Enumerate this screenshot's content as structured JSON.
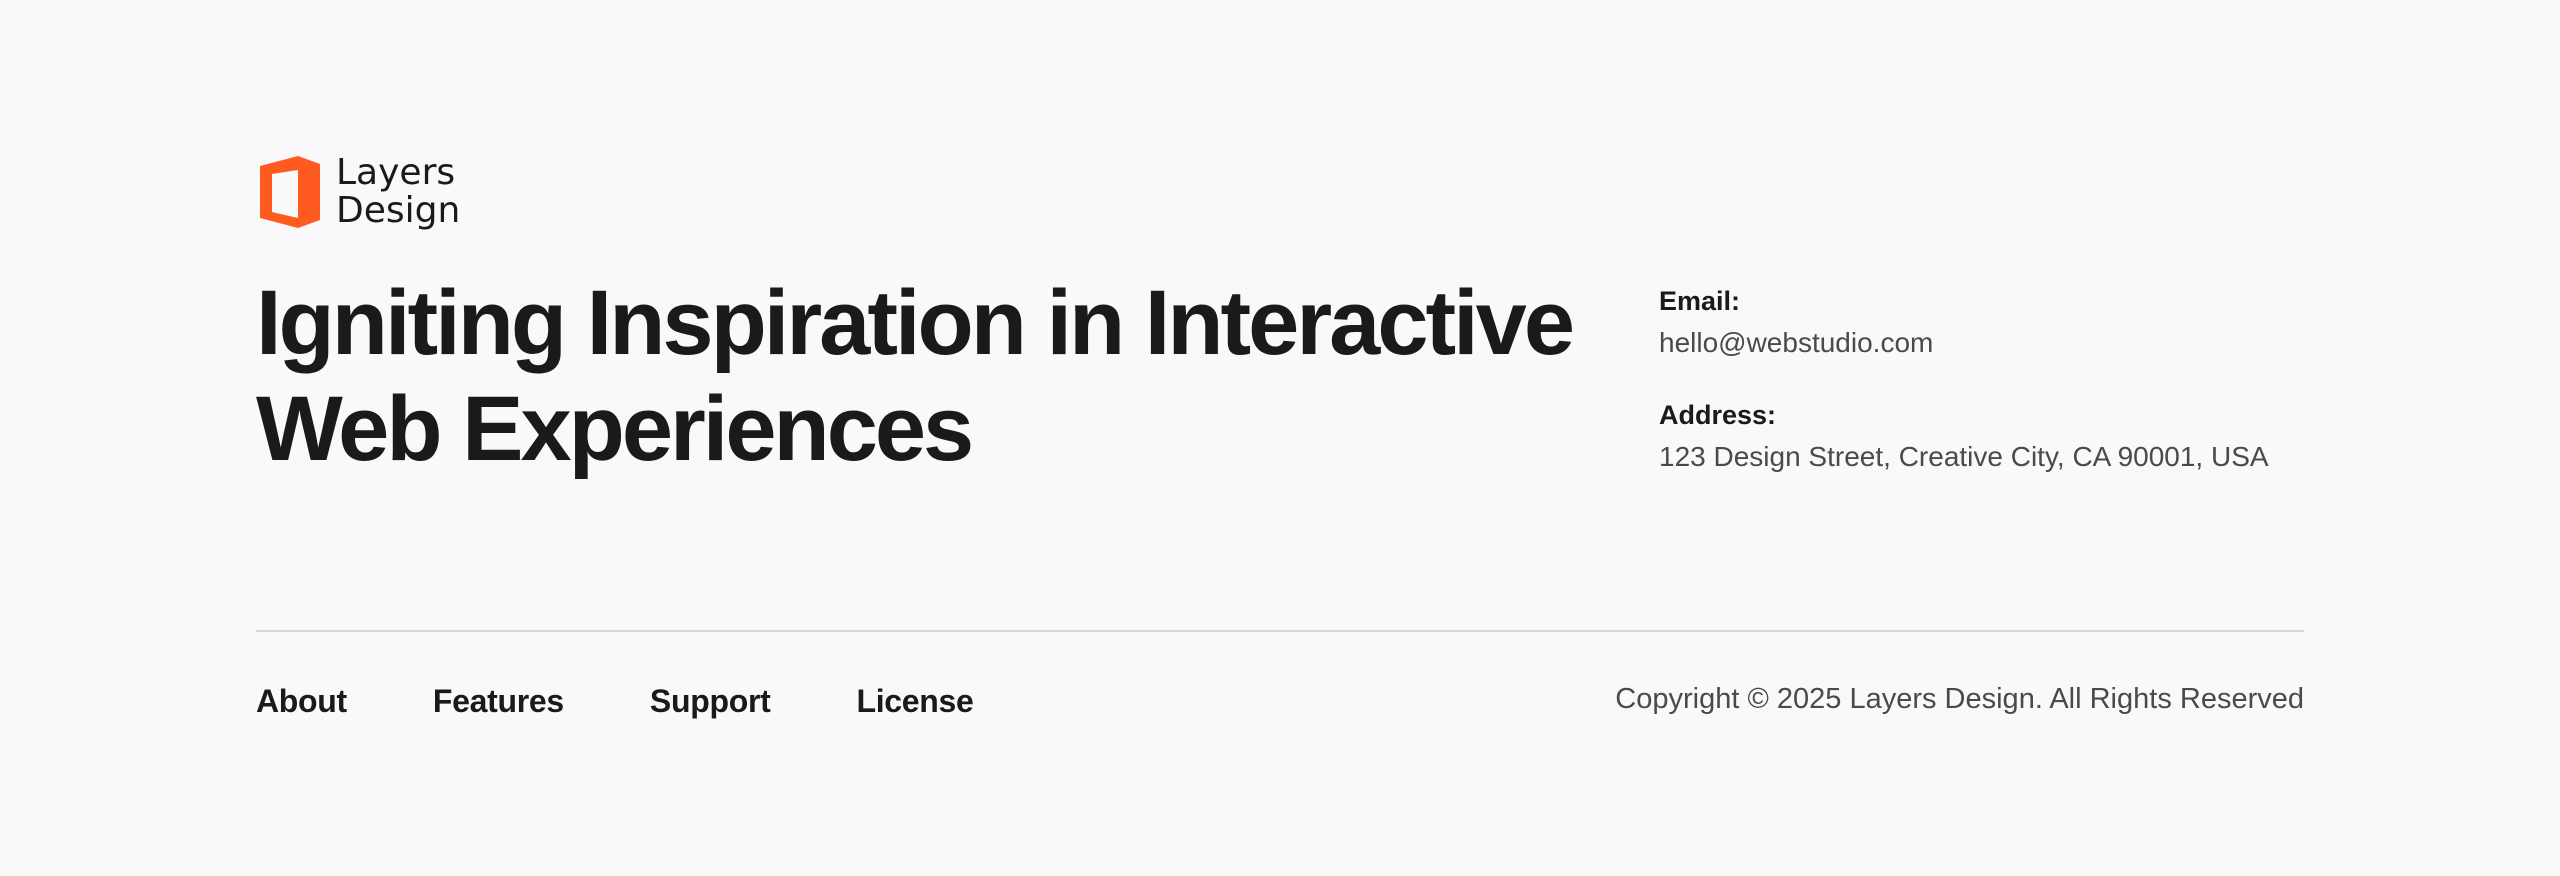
{
  "brand": {
    "name_line1": "Layers",
    "name_line2": "Design",
    "logo_icon": "office-door-icon",
    "accent_color": "#FF5A1F"
  },
  "hero": {
    "headline_line1": "Igniting Inspiration in Interactive",
    "headline_line2": "Web Experiences"
  },
  "contact": {
    "email_label": "Email:",
    "email_value": "hello@webstudio.com",
    "address_label": "Address:",
    "address_value": "123 Design Street, Creative City, CA 90001, USA"
  },
  "nav": {
    "items": [
      {
        "label": "About"
      },
      {
        "label": "Features"
      },
      {
        "label": "Support"
      },
      {
        "label": "License"
      }
    ]
  },
  "footer": {
    "copyright": "Copyright © 2025 Layers Design. All Rights Reserved"
  }
}
